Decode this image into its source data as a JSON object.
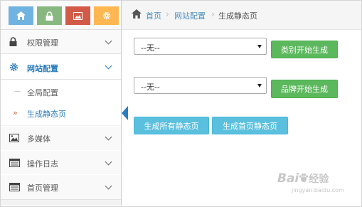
{
  "shortcuts": [
    {
      "icon": "home-icon",
      "color": "#6fb3e0"
    },
    {
      "icon": "lock-icon",
      "color": "#87b87f"
    },
    {
      "icon": "image-icon",
      "color": "#d15b47"
    },
    {
      "icon": "gear-icon",
      "color": "#ffb752"
    }
  ],
  "sidebar": {
    "items": [
      {
        "label": "权限管理",
        "icon": "lock-icon"
      },
      {
        "label": "网站配置",
        "icon": "gear-icon",
        "active": true
      },
      {
        "label": "多媒体",
        "icon": "image-icon"
      },
      {
        "label": "操作日志",
        "icon": "list-icon"
      },
      {
        "label": "首页管理",
        "icon": "list-icon"
      }
    ],
    "submenu": [
      {
        "label": "全局配置"
      },
      {
        "label": "生成静态页",
        "active": true
      }
    ]
  },
  "breadcrumb": {
    "home": "首页",
    "section": "网站配置",
    "current": "生成静态页"
  },
  "form": {
    "category_select": "--无--",
    "category_button": "类别开始生成",
    "brand_select": "--无--",
    "brand_button": "品牌开始生成",
    "all_button": "生成所有静态页",
    "home_button": "生成首页静态页"
  },
  "watermark": {
    "brand": "Bai",
    "brand_tail": "经验",
    "url": "jingyan.baidu.com"
  }
}
